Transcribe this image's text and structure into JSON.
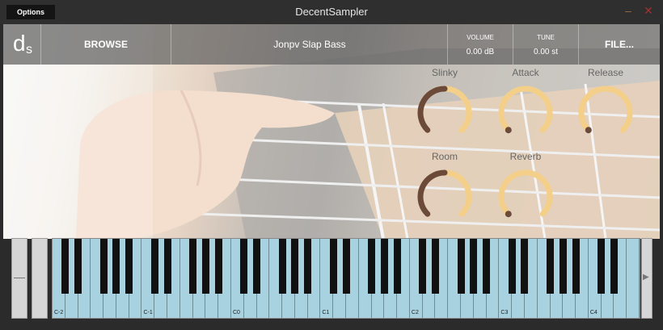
{
  "window": {
    "title": "DecentSampler",
    "options_label": "Options",
    "minimize_glyph": "–",
    "close_glyph": "✕",
    "min_color": "#9a6a3a",
    "close_color": "#a03030"
  },
  "header": {
    "logo_d": "d",
    "logo_s": "s",
    "browse_label": "BROWSE",
    "preset_name": "Jonpv Slap Bass",
    "volume": {
      "label": "VOLUME",
      "value": "0.00 dB"
    },
    "tune": {
      "label": "TUNE",
      "value": "0.00 st"
    },
    "file_label": "FILE..."
  },
  "knobs": [
    {
      "label": "Slinky",
      "value": 0.5
    },
    {
      "label": "Attack",
      "value": 0.0
    },
    {
      "label": "Release",
      "value": 0.0
    },
    {
      "label": "Room",
      "value": 0.5
    },
    {
      "label": "Reverb",
      "value": 0.0
    }
  ],
  "knob_colors": {
    "track": "#f3cf8a",
    "value": "#6b4a3a"
  },
  "keyboard": {
    "octave_labels": [
      "C-2",
      "C-1",
      "C0",
      "C1",
      "C2",
      "C3",
      "C4"
    ],
    "scroll_arrow": "▶",
    "white_key_color": "#a9d2e0"
  }
}
